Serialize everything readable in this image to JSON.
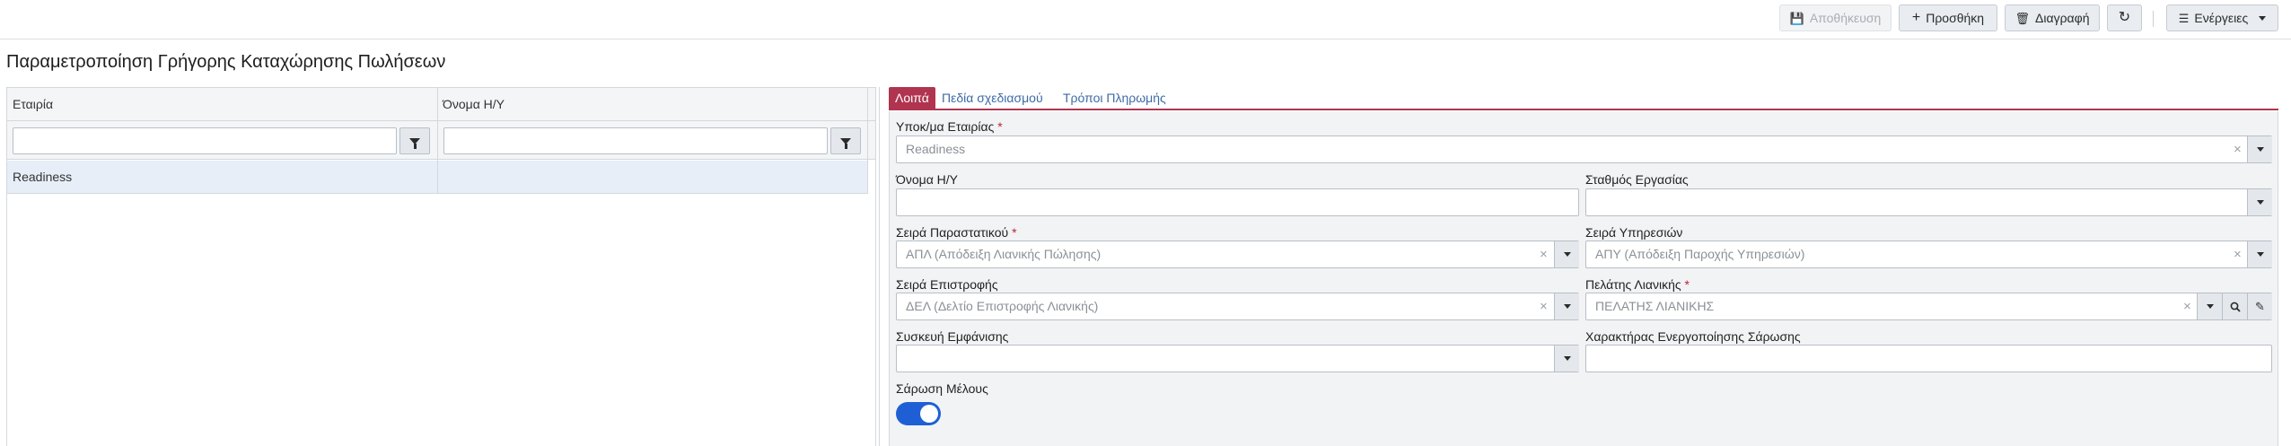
{
  "toolbar": {
    "save_label": "Αποθήκευση",
    "add_label": "Προσθήκη",
    "delete_label": "Διαγραφή",
    "actions_label": "Ενέργειες"
  },
  "page": {
    "title": "Παραμετροποίηση Γρήγορης Καταχώρησης Πωλήσεων"
  },
  "grid": {
    "columns": [
      "Εταιρία",
      "Όνομα Η/Υ"
    ],
    "rows": [
      [
        "Readiness",
        ""
      ]
    ]
  },
  "tabs": [
    {
      "label": "Λοιπά",
      "active": true
    },
    {
      "label": "Πεδία σχεδιασμού",
      "active": false
    },
    {
      "label": "Τρόποι Πληρωμής",
      "active": false
    }
  ],
  "form": {
    "company": {
      "label": "Υποκ/μα Εταιρίας",
      "required": "*",
      "value": "Readiness"
    },
    "pc_name": {
      "label": "Όνομα Η/Υ",
      "value": ""
    },
    "workstation": {
      "label": "Σταθμός Εργασίας",
      "value": ""
    },
    "doc_series": {
      "label": "Σειρά Παραστατικού",
      "required": "*",
      "value": "ΑΠΛ (Απόδειξη Λιανικής Πώλησης)"
    },
    "service_series": {
      "label": "Σειρά Υπηρεσιών",
      "value": "ΑΠΥ (Απόδειξη Παροχής Υπηρεσιών)"
    },
    "return_series": {
      "label": "Σειρά Επιστροφής",
      "value": "ΔΕΛ (Δελτίο Επιστροφής Λιανικής)"
    },
    "retail_customer": {
      "label": "Πελάτης Λιανικής",
      "required": "*",
      "value": "ΠΕΛΑΤΗΣ ΛΙΑΝΙΚΗΣ"
    },
    "display_device": {
      "label": "Συσκευή Εμφάνισης",
      "value": ""
    },
    "scan_char": {
      "label": "Χαρακτήρας Ενεργοποίησης Σάρωσης",
      "value": ""
    },
    "member_scan": {
      "label": "Σάρωση Μέλους",
      "enabled": true
    }
  },
  "icons": {
    "clear": "×",
    "search": "🔍",
    "edit": "✎"
  },
  "colors": {
    "accent": "#b0344f",
    "toggle_on": "#1f5fd6",
    "selected_row": "#e7eef8"
  }
}
